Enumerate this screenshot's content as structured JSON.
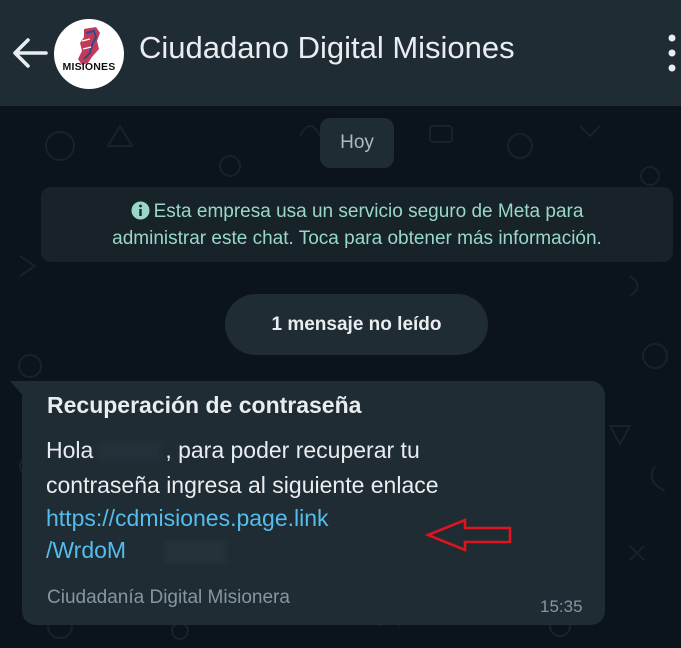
{
  "header": {
    "title": "Ciudadano Digital Misiones",
    "avatar_text": "MISIONES"
  },
  "chat": {
    "date_chip": "Hoy",
    "system_notice": {
      "line1": "Esta empresa usa un servicio seguro de Meta para",
      "line2": "administrar este chat. Toca para obtener más información."
    },
    "unread_chip": "1 mensaje no leído",
    "message": {
      "title": "Recuperación de contraseña",
      "greeting": "Hola",
      "line1_rest": ", para poder recuperar tu",
      "line2": "contraseña ingresa al siguiente enlace",
      "link_line1": "https://cdmisiones.page.link",
      "link_line2": "/WrdoM",
      "footer": "Ciudadanía Digital Misionera",
      "time": "15:35"
    }
  },
  "colors": {
    "header_bg": "#1f2c34",
    "chat_bg": "#0b141a",
    "bubble_bg": "#1f2c34",
    "link": "#53bdeb",
    "notice_text": "#99d8c8",
    "annotation_arrow": "#e0141e"
  },
  "icons": [
    "back-arrow-icon",
    "info-icon",
    "more-vert-icon",
    "red-arrow-annotation"
  ]
}
